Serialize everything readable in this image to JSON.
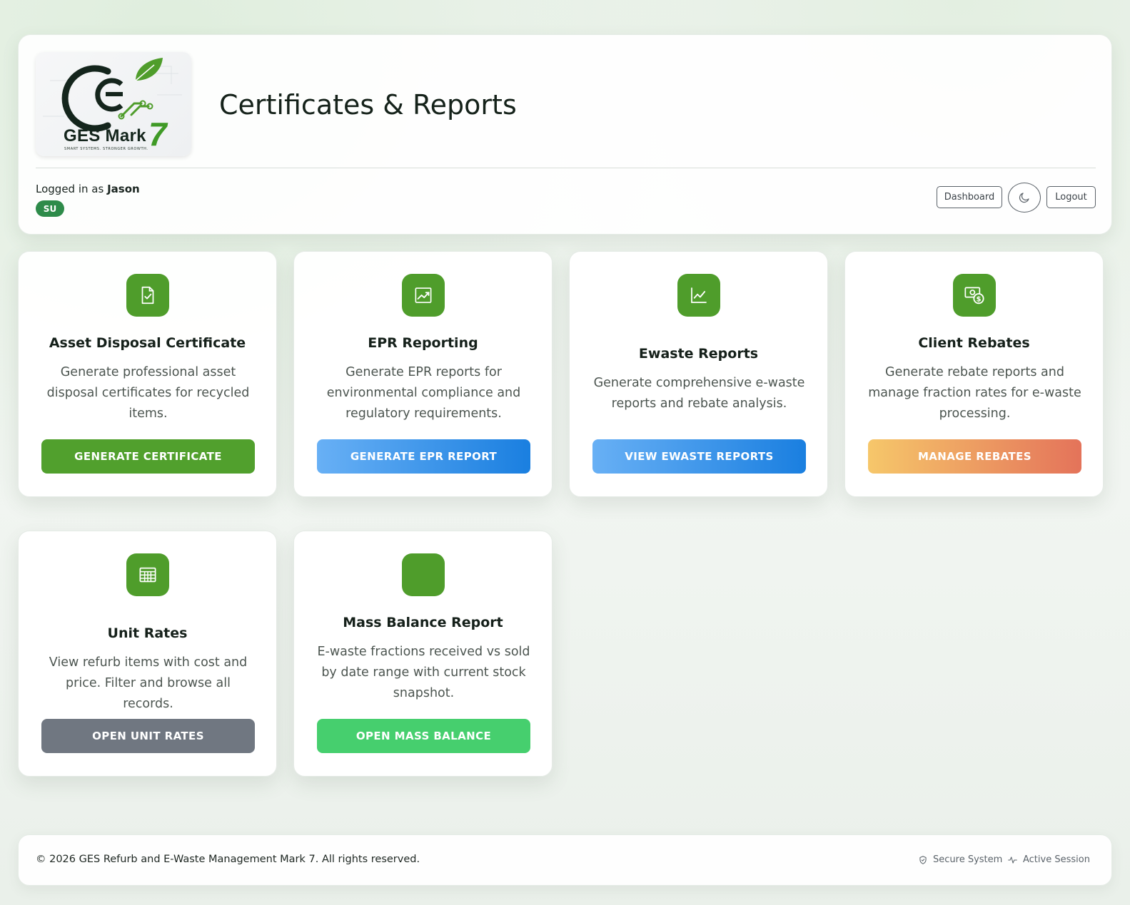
{
  "header": {
    "logo_brand": "GES Mark",
    "logo_number": "7",
    "logo_tagline": "SMART SYSTEMS. STRONGER GROWTH.",
    "title": "Certificates & Reports",
    "logged_in_prefix": "Logged in as",
    "username": "Jason",
    "role_badge": "SU",
    "dashboard_label": "Dashboard",
    "theme_icon": "moon-icon",
    "logout_label": "Logout"
  },
  "cards": [
    {
      "icon": "file-check-icon",
      "title": "Asset Disposal Certificate",
      "description": "Generate professional asset disposal certificates for recycled items.",
      "button": "GENERATE CERTIFICATE",
      "button_color": "#51a02d"
    },
    {
      "icon": "trending-up-icon",
      "title": "EPR Reporting",
      "description": "Generate EPR reports for environmental compliance and regulatory requirements.",
      "button": "GENERATE EPR REPORT",
      "button_color": "#1a7fe0"
    },
    {
      "icon": "line-chart-icon",
      "title": "Ewaste Reports",
      "description": "Generate comprehensive e-waste reports and rebate analysis.",
      "button": "VIEW EWASTE REPORTS",
      "button_color": "#1a7fe0"
    },
    {
      "icon": "cash-coin-icon",
      "title": "Client Rebates",
      "description": "Generate rebate reports and manage fraction rates for e-waste processing.",
      "button": "MANAGE REBATES",
      "button_color": "#e4735a"
    },
    {
      "icon": "table-icon",
      "title": "Unit Rates",
      "description": "View refurb items with cost and price. Filter and browse all records.",
      "button": "OPEN UNIT RATES",
      "button_color": "#707781"
    },
    {
      "icon": "blank-icon",
      "title": "Mass Balance Report",
      "description": "E-waste fractions received vs sold by date range with current stock snapshot.",
      "button": "OPEN MASS BALANCE",
      "button_color": "#46cf6e"
    }
  ],
  "footer": {
    "copyright": "© 2026 GES Refurb and E-Waste Management Mark 7. All rights reserved.",
    "secure_label": "Secure System",
    "session_label": "Active Session"
  },
  "colors": {
    "accent_green": "#4f9d2b",
    "badge_green": "#2e8b4a"
  }
}
